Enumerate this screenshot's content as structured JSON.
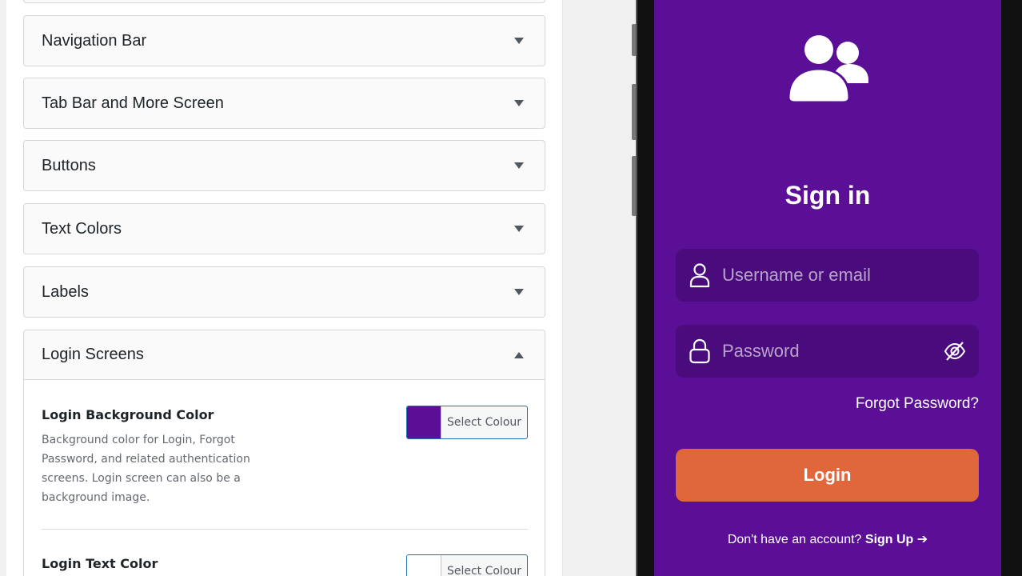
{
  "settings_panel": {
    "sections": [
      {
        "label": "Navigation Bar",
        "expanded": false
      },
      {
        "label": "Tab Bar and More Screen",
        "expanded": false
      },
      {
        "label": "Buttons",
        "expanded": false
      },
      {
        "label": "Text Colors",
        "expanded": false
      },
      {
        "label": "Labels",
        "expanded": false
      },
      {
        "label": "Login Screens",
        "expanded": true
      }
    ],
    "login_screens": {
      "background_color": {
        "title": "Login Background Color",
        "description": "Background color for Login, Forgot Password, and related authentication screens. Login screen can also be a background image.",
        "button_label": "Select Colour",
        "swatch_color": "#5b0f96"
      },
      "text_color": {
        "title": "Login Text Color",
        "button_label": "Select Colour",
        "swatch_color": "#ffffff"
      }
    }
  },
  "phone_preview": {
    "background_color": "#5b0f96",
    "logo_icon": "users-icon",
    "title": "Sign in",
    "username_placeholder": "Username or email",
    "password_placeholder": "Password",
    "forgot_password": "Forgot Password?",
    "login_button": "Login",
    "login_button_color": "#e0663c",
    "signup_prompt": "Don't have an account?",
    "signup_link": "Sign Up ➔"
  }
}
